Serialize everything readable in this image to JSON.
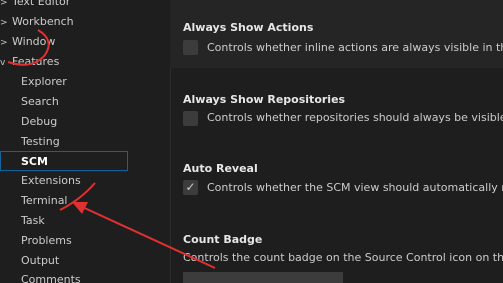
{
  "sidebar": {
    "items": [
      {
        "label": "Text Editor",
        "chevron": ">"
      },
      {
        "label": "Workbench",
        "chevron": ">"
      },
      {
        "label": "Window",
        "chevron": ">"
      },
      {
        "label": "Features",
        "chevron": "v"
      },
      {
        "label": "Explorer"
      },
      {
        "label": "Search"
      },
      {
        "label": "Debug"
      },
      {
        "label": "Testing"
      },
      {
        "label": "SCM"
      },
      {
        "label": "Extensions"
      },
      {
        "label": "Terminal"
      },
      {
        "label": "Task"
      },
      {
        "label": "Problems"
      },
      {
        "label": "Output"
      },
      {
        "label": "Comments"
      }
    ]
  },
  "settings": [
    {
      "title": "Always Show Actions",
      "description": "Controls whether inline actions are always visible in the Sc",
      "checked": false
    },
    {
      "title": "Always Show Repositories",
      "description": "Controls whether repositories should always be visible in t",
      "checked": false
    },
    {
      "title": "Auto Reveal",
      "description": "Controls whether the SCM view should automatically reve",
      "checked": true,
      "check_glyph": "✓"
    },
    {
      "title": "Count Badge",
      "description": "Controls the count badge on the Source Control icon on the A"
    }
  ],
  "colors": {
    "annotation": "#e03131",
    "selection_border": "#0e639c"
  }
}
